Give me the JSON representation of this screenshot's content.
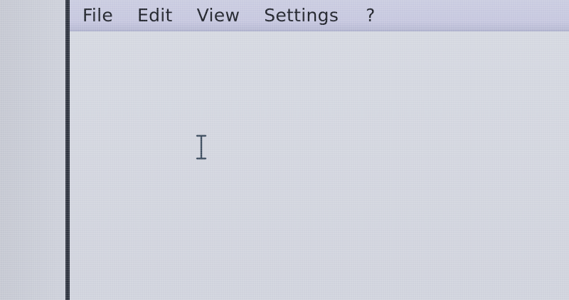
{
  "menubar": {
    "items": [
      {
        "label": "File"
      },
      {
        "label": "Edit"
      },
      {
        "label": "View"
      },
      {
        "label": "Settings"
      },
      {
        "label": "?"
      }
    ]
  },
  "colors": {
    "menubar": "#c6c8df",
    "content": "#d2d5df",
    "window_border": "#2f3440",
    "text": "#1c1f28",
    "cursor": "#3a4a5c"
  },
  "icons": {
    "cursor": "i-beam-cursor-icon"
  }
}
